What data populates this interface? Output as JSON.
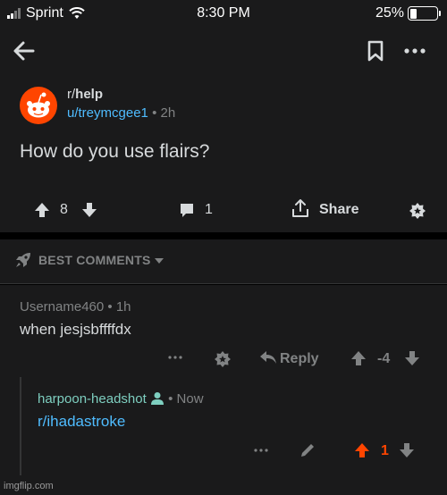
{
  "status_bar": {
    "carrier": "Sprint",
    "time": "8:30 PM",
    "battery_percent": "25%",
    "battery_level": 0.25
  },
  "nav": {
    "back_icon": "back-arrow-icon",
    "bookmark_icon": "bookmark-icon",
    "more_icon": "more-dots-icon"
  },
  "post": {
    "subreddit_prefix": "r/",
    "subreddit_name": "help",
    "author": "u/treymcgee1",
    "separator": "•",
    "age": "2h",
    "title": "How do you use flairs?",
    "score": "8",
    "comment_count": "1",
    "share_label": "Share"
  },
  "comments_header": {
    "label": "BEST COMMENTS"
  },
  "comments": [
    {
      "author": "Username460",
      "separator": "•",
      "age": "1h",
      "body": "when jesjsbffffdx",
      "reply_label": "Reply",
      "score": "-4"
    },
    {
      "author": "harpoon-headshot",
      "separator": "•",
      "age": "Now",
      "body": "r/ihadastroke",
      "score": "1",
      "vote_state": "upvoted"
    }
  ],
  "colors": {
    "background": "#1a1a1b",
    "accent_orange": "#ff4500",
    "link_blue": "#4fbcff",
    "meta_gray": "#818384"
  },
  "watermark": "imgflip.com"
}
